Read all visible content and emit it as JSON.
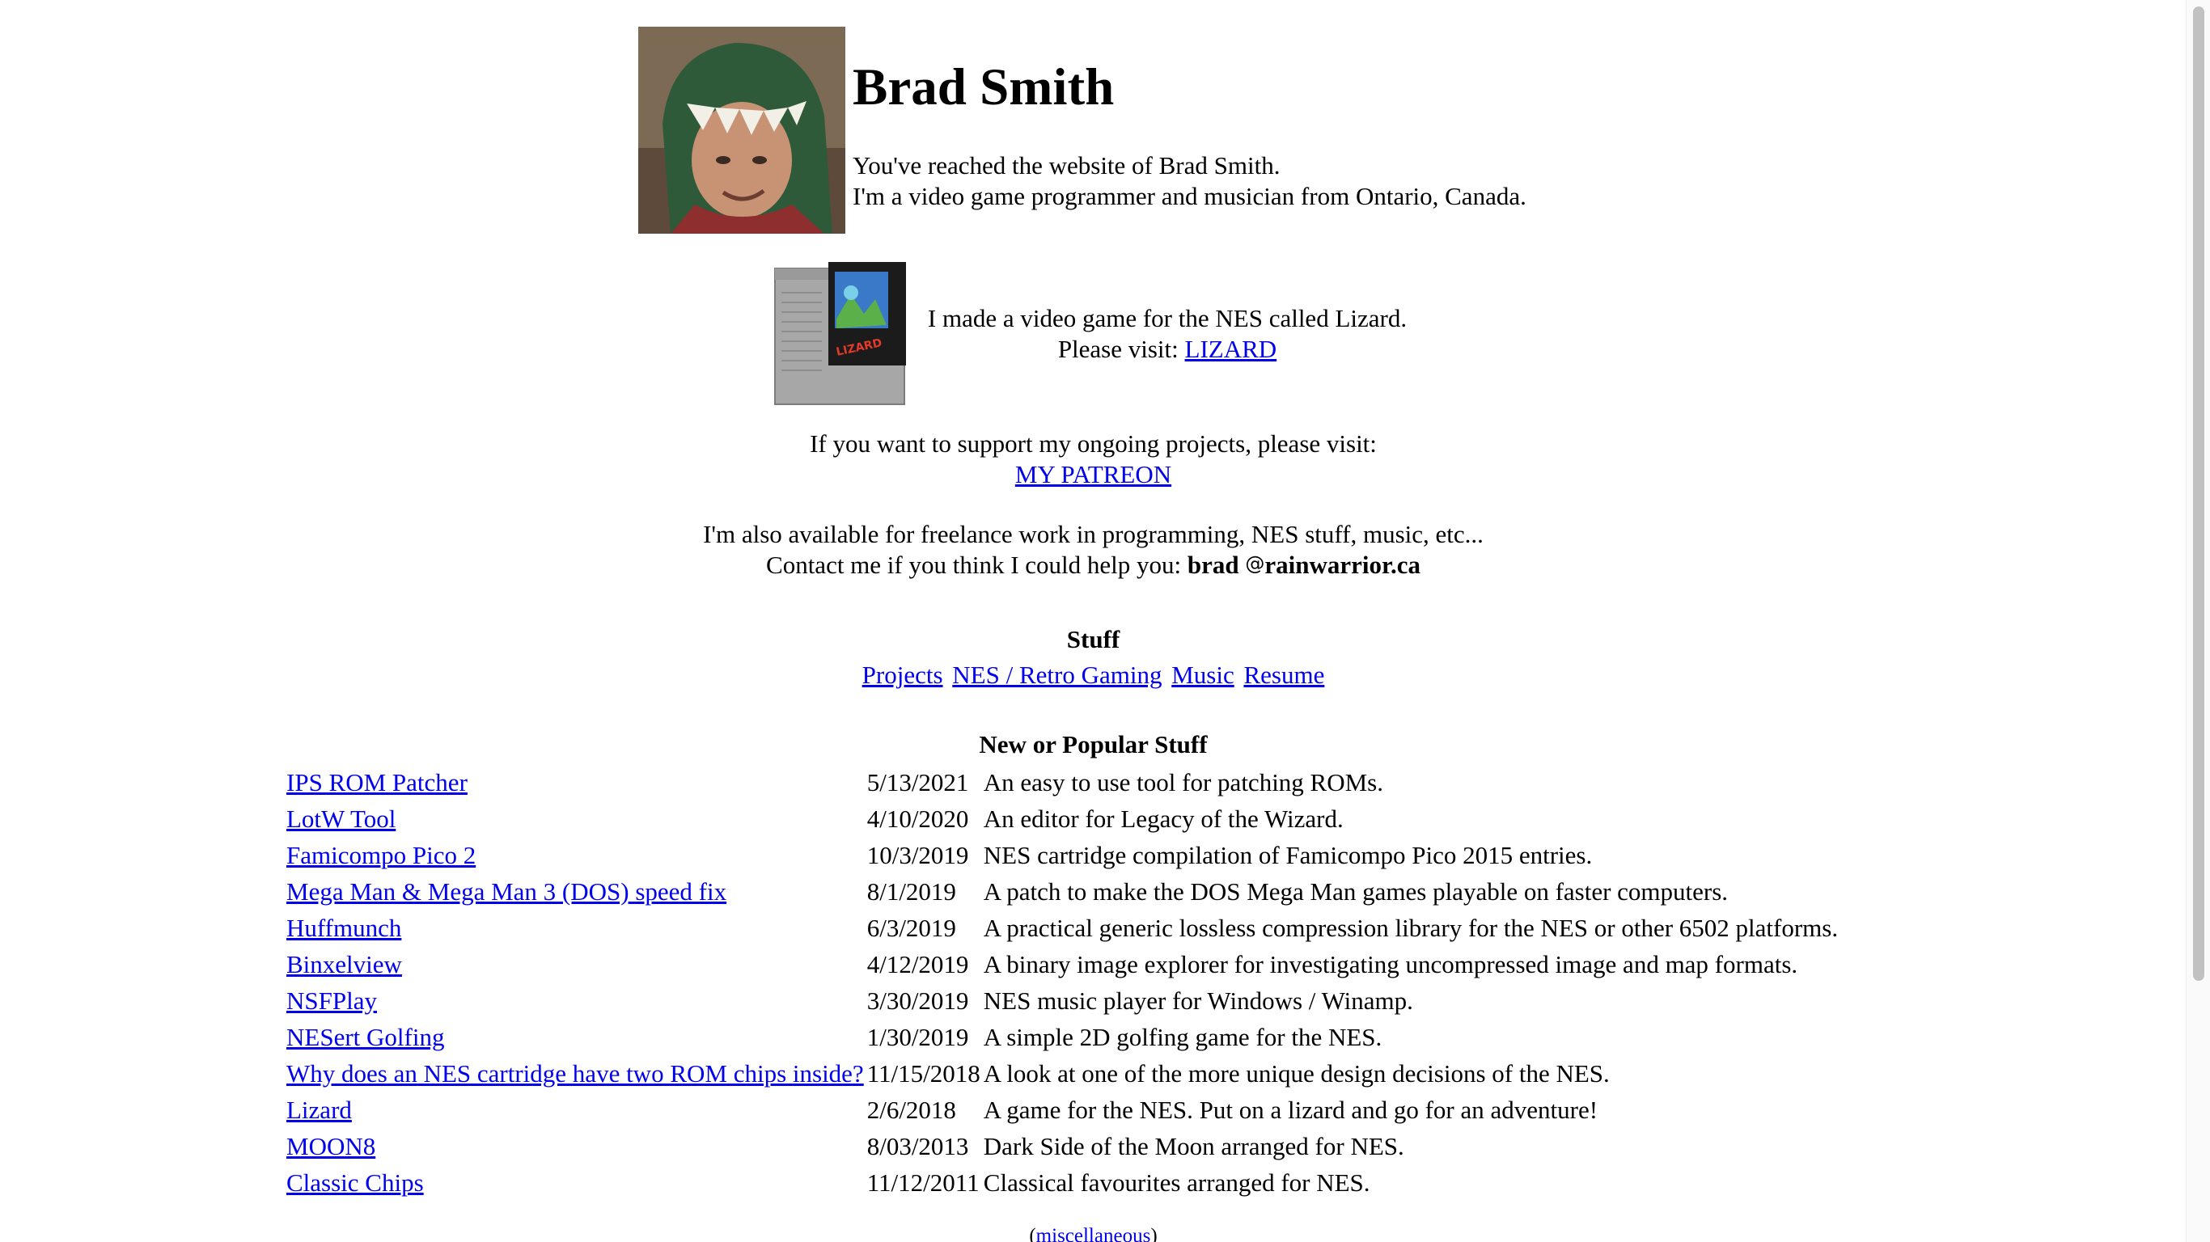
{
  "header": {
    "name": "Brad Smith",
    "intro_line1": "You've reached the website of Brad Smith.",
    "intro_line2": "I'm a video game programmer and musician from Ontario, Canada."
  },
  "lizard": {
    "line1": "I made a video game for the NES called Lizard.",
    "visit_prefix": "Please visit: ",
    "link_label": "LIZARD",
    "cart_label": "LIZARD"
  },
  "patreon": {
    "text": "If you want to support my ongoing projects, please visit:",
    "link_label": "MY PATREON"
  },
  "freelance": {
    "line1": "I'm also available for freelance work in programming, NES stuff, music, etc...",
    "contact_prefix": "Contact me if you think I could help you: ",
    "email_user": "brad",
    "email_at": "@",
    "email_domain": "rainwarrior.ca"
  },
  "stuff": {
    "title": "Stuff",
    "links": [
      "Projects",
      "NES / Retro Gaming",
      "Music",
      "Resume"
    ]
  },
  "new_stuff": {
    "title": "New or Popular Stuff",
    "items": [
      {
        "name": "IPS ROM Patcher",
        "date": "5/13/2021",
        "desc": "An easy to use tool for patching ROMs."
      },
      {
        "name": "LotW Tool",
        "date": "4/10/2020",
        "desc": "An editor for Legacy of the Wizard."
      },
      {
        "name": "Famicompo Pico 2",
        "date": "10/3/2019",
        "desc": "NES cartridge compilation of Famicompo Pico 2015 entries."
      },
      {
        "name": "Mega Man & Mega Man 3 (DOS) speed fix",
        "date": "8/1/2019",
        "desc": "A patch to make the DOS Mega Man games playable on faster computers."
      },
      {
        "name": "Huffmunch",
        "date": "6/3/2019",
        "desc": "A practical generic lossless compression library for the NES or other 6502 platforms."
      },
      {
        "name": "Binxelview",
        "date": "4/12/2019",
        "desc": "A binary image explorer for investigating uncompressed image and map formats."
      },
      {
        "name": "NSFPlay",
        "date": "3/30/2019",
        "desc": "NES music player for Windows / Winamp."
      },
      {
        "name": "NESert Golfing",
        "date": "1/30/2019",
        "desc": "A simple 2D golfing game for the NES."
      },
      {
        "name": "Why does an NES cartridge have two ROM chips inside?",
        "date": "11/15/2018",
        "desc": "A look at one of the more unique design decisions of the NES."
      },
      {
        "name": "Lizard",
        "date": "2/6/2018",
        "desc": "A game for the NES. Put on a lizard and go for an adventure!"
      },
      {
        "name": "MOON8",
        "date": "8/03/2013",
        "desc": "Dark Side of the Moon arranged for NES."
      },
      {
        "name": "Classic Chips",
        "date": "11/12/2011",
        "desc": "Classical favourites arranged for NES."
      }
    ]
  },
  "misc": {
    "open": "(",
    "link_label": "miscellaneous",
    "close": ")"
  },
  "colors": {
    "link": "#0000ee",
    "text": "#000000",
    "background": "#ffffff"
  }
}
